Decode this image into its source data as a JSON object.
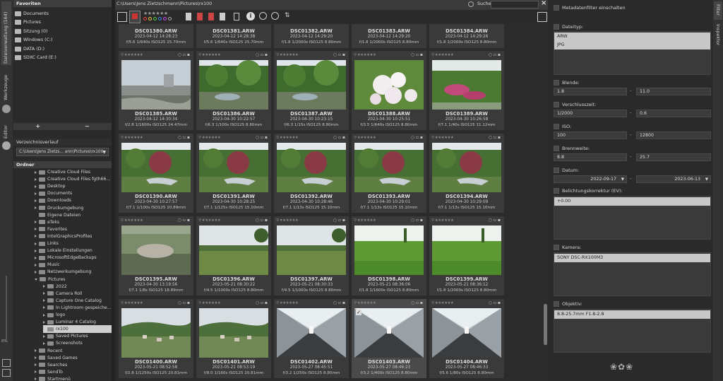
{
  "rail": {
    "tab_browse": "Dateiverwaltung (164)",
    "tab_develop": "Werkzeuge",
    "tab_editor": "Editor",
    "zoom_pct": "0%"
  },
  "favorites": {
    "header": "Favoriten",
    "items": [
      "Documents",
      "Pictures",
      "Sitzung (0)",
      "Windows (C:)",
      "DATA (D:)",
      "SDXC Card (E:)"
    ],
    "add_label": "+",
    "remove_label": "−"
  },
  "history": {
    "header": "Verzeichnisverlauf",
    "value": "C:\\Users\\Jens Zietzs... ann\\Pictures\\rx100"
  },
  "folders": {
    "header": "Ordner",
    "items": [
      {
        "label": "Creative Cloud Files",
        "level": 0,
        "open": false
      },
      {
        "label": "Creative Cloud Files fgth66...",
        "level": 0,
        "open": false
      },
      {
        "label": "Desktop",
        "level": 0,
        "open": false
      },
      {
        "label": "Documents",
        "level": 0,
        "open": false
      },
      {
        "label": "Downloads",
        "level": 0,
        "open": false
      },
      {
        "label": "Druckumgebung",
        "level": 0,
        "open": false
      },
      {
        "label": "Eigene Dateien",
        "level": 0,
        "open": null
      },
      {
        "label": "eTeks",
        "level": 0,
        "open": false
      },
      {
        "label": "Favorites",
        "level": 0,
        "open": false
      },
      {
        "label": "IntelGraphicsProfiles",
        "level": 0,
        "open": false
      },
      {
        "label": "Links",
        "level": 0,
        "open": false
      },
      {
        "label": "Lokale Einstellungen",
        "level": 0,
        "open": false
      },
      {
        "label": "MicrosoftEdgeBackups",
        "level": 0,
        "open": false
      },
      {
        "label": "Music",
        "level": 0,
        "open": false
      },
      {
        "label": "Netzwerkumgebung",
        "level": 0,
        "open": false
      },
      {
        "label": "Pictures",
        "level": 0,
        "open": true
      },
      {
        "label": "2022",
        "level": 1,
        "open": false
      },
      {
        "label": "Camera Roll",
        "level": 1,
        "open": false
      },
      {
        "label": "Capture One Catalog",
        "level": 1,
        "open": false
      },
      {
        "label": "In Lightroom gespeiche...",
        "level": 1,
        "open": false
      },
      {
        "label": "logo",
        "level": 1,
        "open": false
      },
      {
        "label": "Luminar 4 Catalog",
        "level": 1,
        "open": false
      },
      {
        "label": "rx100",
        "level": 1,
        "open": null,
        "selected": true
      },
      {
        "label": "Saved Pictures",
        "level": 1,
        "open": false
      },
      {
        "label": "Screenshots",
        "level": 1,
        "open": false
      },
      {
        "label": "Recent",
        "level": 0,
        "open": false
      },
      {
        "label": "Saved Games",
        "level": 0,
        "open": false
      },
      {
        "label": "Searches",
        "level": 0,
        "open": false
      },
      {
        "label": "SendTo",
        "level": 0,
        "open": false
      },
      {
        "label": "Startmenü",
        "level": 0,
        "open": false
      }
    ]
  },
  "pathbar": {
    "path": "C:\\Users\\Jens Zietzschmann\\Pictures\\rx100",
    "search_label": "Suche:",
    "search_value": "",
    "close_label": "×"
  },
  "partial_row": [
    {
      "name": "DSC01380.ARW",
      "date": "2023-04-12 14:28:23",
      "exif": "f/5.6 1/640s ISO125 25.70mm"
    },
    {
      "name": "DSC01381.ARW",
      "date": "2023-04-12 14:28:38",
      "exif": "f/5.6 1/640s ISO125 25.70mm"
    },
    {
      "name": "DSC01382.ARW",
      "date": "2023-04-12 14:29:20",
      "exif": "f/1.8 1/2000s ISO125 8.80mm"
    },
    {
      "name": "DSC01383.ARW",
      "date": "2023-04-12 14:29:20",
      "exif": "f/1.8 1/2000s ISO125 8.80mm"
    },
    {
      "name": "DSC01384.ARW",
      "date": "2023-04-12 14:29:26",
      "exif": "f/1.8 1/2000s ISO125 8.80mm"
    }
  ],
  "images": [
    {
      "name": "DSC01385.ARW",
      "date": "2023-04-12 14:30:34",
      "exif": "f/2.8 1/1600s ISO125 24.47mm",
      "scene": "lake"
    },
    {
      "name": "DSC01386.ARW",
      "date": "2023-04-30 10:22:57",
      "exif": "f/6.3 1/100s ISO125 8.80mm",
      "scene": "garden"
    },
    {
      "name": "DSC01387.ARW",
      "date": "2023-04-30 10:23:15",
      "exif": "f/6.3 1/15s ISO125 8.80mm",
      "scene": "garden"
    },
    {
      "name": "DSC01388.ARW",
      "date": "2023-04-30 10:25:51",
      "exif": "f/3.5 1/640s ISO125 8.80mm",
      "scene": "blossom"
    },
    {
      "name": "DSC01389.ARW",
      "date": "2023-04-30 10:26:58",
      "exif": "f/7.1 1/40s ISO125 11.12mm",
      "scene": "flowerbed"
    },
    {
      "name": "DSC01390.ARW",
      "date": "2023-04-30 10:27:57",
      "exif": "f/7.1 1/100s ISO125 10.89mm",
      "scene": "tree"
    },
    {
      "name": "DSC01391.ARW",
      "date": "2023-04-30 10:28:25",
      "exif": "f/7.1 1/125s ISO125 15.10mm",
      "scene": "tree"
    },
    {
      "name": "DSC01392.ARW",
      "date": "2023-04-30 10:28:46",
      "exif": "f/7.1 1/13s ISO125 15.10mm",
      "scene": "tree"
    },
    {
      "name": "DSC01393.ARW",
      "date": "2023-04-30 10:29:01",
      "exif": "f/7.1 1/13s ISO125 15.10mm",
      "scene": "tree"
    },
    {
      "name": "DSC01394.ARW",
      "date": "2023-04-30 10:29:09",
      "exif": "f/7.1 1/13s ISO125 15.10mm",
      "scene": "tree"
    },
    {
      "name": "DSC01395.ARW",
      "date": "2023-04-30 13:19:56",
      "exif": "f/7.1 1/8s ISO125 18.89mm",
      "scene": "animal"
    },
    {
      "name": "DSC01396.ARW",
      "date": "2023-05-21 08:30:22",
      "exif": "f/4.5 1/1000s ISO125 8.80mm",
      "scene": "meadow"
    },
    {
      "name": "DSC01397.ARW",
      "date": "2023-05-21 08:30:33",
      "exif": "f/4.5 1/1000s ISO125 8.80mm",
      "scene": "meadow"
    },
    {
      "name": "DSC01398.ARW",
      "date": "2023-05-21 08:36:06",
      "exif": "f/1.8 1/1600s ISO125 8.80mm",
      "scene": "grass"
    },
    {
      "name": "DSC01399.ARW",
      "date": "2023-05-21 08:36:12",
      "exif": "f/1.8 1/2000s ISO125 8.80mm",
      "scene": "grass"
    },
    {
      "name": "DSC01400.ARW",
      "date": "2023-05-21 08:52:58",
      "exif": "f/2.8 1/1250s ISO125 20.81mm",
      "scene": "village"
    },
    {
      "name": "DSC01401.ARW",
      "date": "2023-05-21 08:53:19",
      "exif": "f/8.0 1/160s ISO125 20.81mm",
      "scene": "village"
    },
    {
      "name": "DSC01402.ARW",
      "date": "2023-05-27 08:45:51",
      "exif": "f/3.2 1/250s ISO125 8.80mm",
      "scene": "hall"
    },
    {
      "name": "DSC01403.ARW",
      "date": "2023-05-27 08:46:23",
      "exif": "f/3.2 1/400s ISO125 8.80mm",
      "scene": "hall",
      "selected": true
    },
    {
      "name": "DSC01404.ARW",
      "date": "2023-05-27 08:46:33",
      "exif": "f/5.6 1/80s ISO125 8.80mm",
      "scene": "hall"
    }
  ],
  "filter": {
    "metadata_label": "Metadatenfilter einschalten",
    "filetype_label": "Dateityp:",
    "filetypes": [
      "ARW",
      "JPG"
    ],
    "aperture_label": "Blende:",
    "aperture_min": "1.8",
    "aperture_max": "11.0",
    "shutter_label": "Verschlusszeit:",
    "shutter_min": "1/2000",
    "shutter_max": "0.6",
    "iso_label": "ISO:",
    "iso_min": "100",
    "iso_max": "12800",
    "focal_label": "Brennweite:",
    "focal_min": "8.8",
    "focal_max": "25.7",
    "date_label": "Datum:",
    "date_min": "2022-09-17",
    "date_max": "2023-06-13",
    "exposure_label": "Belichtungskorrektur (EV):",
    "exposure_value": "+0.00",
    "camera_label": "Kamera:",
    "camera_value": "SONY DSC-RX100M3",
    "lens_label": "Objektiv:",
    "lens_value": "8.8-25.7mm F1.8-2.8",
    "dash": "-"
  },
  "rrail": {
    "tab_filter": "Filter",
    "tab_inspector": "Inspektor"
  }
}
